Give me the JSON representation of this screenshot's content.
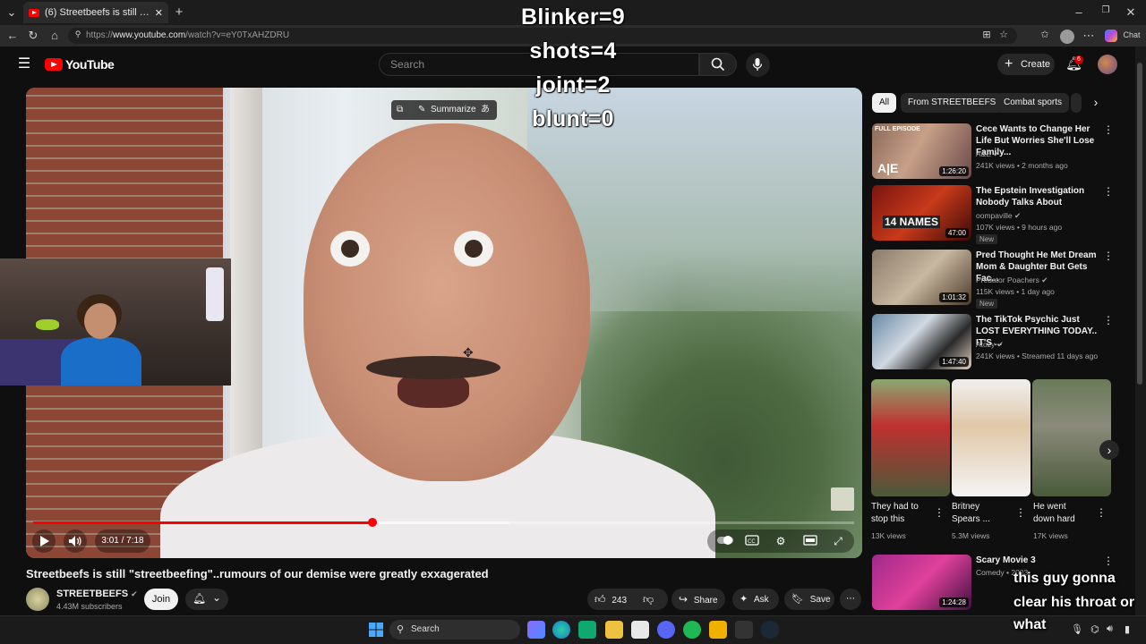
{
  "browser": {
    "tab_title": "(6) Streetbeefs is still \"streetbeefing\"",
    "url_scheme": "https://",
    "url_host": "www.youtube.com",
    "url_path": "/watch?v=eY0TxAHZDRU",
    "chat_label": "Chat"
  },
  "header": {
    "logo_text": "YouTube",
    "search_placeholder": "Search",
    "create_label": "Create",
    "notification_count": "6"
  },
  "overlay_counters": [
    "Blinker=9",
    "shots=4",
    "joint=2",
    "blunt=0"
  ],
  "player": {
    "summarize_label": "Summarize",
    "time_display": "3:01 / 7:18",
    "progress_fraction": 0.413,
    "buffered_fraction": 0.58
  },
  "video": {
    "title": "Streetbeefs is still \"streetbeefing\"..rumours of our demise were greatly exxagerated",
    "channel_name": "STREETBEEFS",
    "subscribers": "4.43M subscribers",
    "join_label": "Join",
    "like_count": "243",
    "share_label": "Share",
    "ask_label": "Ask",
    "save_label": "Save"
  },
  "chips": [
    "All",
    "From STREETBEEFS",
    "Combat sports"
  ],
  "recommendations": [
    {
      "badge": "FULL EPISODE",
      "title": "Cece Wants to Change Her Life But Worries She'll Lose Family...",
      "channel": "A&E",
      "meta": "241K views • 2 months ago",
      "duration": "1:26:20",
      "new": ""
    },
    {
      "badge": "",
      "title": "The Epstein Investigation Nobody Talks About",
      "channel": "oompaville",
      "meta": "107K views • 9 hours ago",
      "duration": "47:00",
      "new": "New",
      "thumb_text": "14 NAMES"
    },
    {
      "badge": "",
      "title": "Pred Thought He Met Dream Mom & Daughter But Gets Fac...",
      "channel": "Predator Poachers",
      "meta": "115K views • 1 day ago",
      "duration": "1:01:32",
      "new": "New"
    },
    {
      "badge": "",
      "title": "The TikTok Psychic Just LOST EVERYTHING TODAY.. IT'S ...",
      "channel": "Atozy",
      "meta": "241K views • Streamed 11 days ago",
      "duration": "1:47:40",
      "new": ""
    }
  ],
  "shorts": [
    {
      "title_l1": "They had to",
      "title_l2": "stop this",
      "views": "13K views"
    },
    {
      "title_l1": "Britney",
      "title_l2": "Spears ...",
      "views": "5.3M views"
    },
    {
      "title_l1": "He went",
      "title_l2": "down hard",
      "views": "17K views"
    }
  ],
  "bottom_rec": {
    "title": "Scary Movie 3",
    "channel": "Comedy • 2003",
    "duration": "1:24:28"
  },
  "caption_lines": [
    "this guy gonna",
    "clear his throat or",
    "what"
  ],
  "taskbar": {
    "search_label": "Search"
  }
}
